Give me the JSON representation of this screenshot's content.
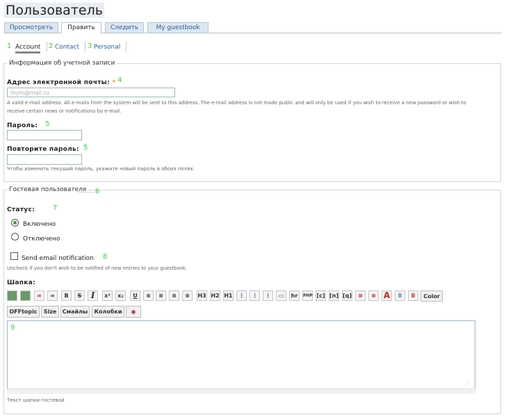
{
  "page": {
    "title": "Пользователь"
  },
  "tabs": [
    "Просмотреть",
    "Править",
    "Следить",
    "My guestbook"
  ],
  "subtabs": {
    "account": "Account",
    "contact": "Contact",
    "personal": "Personal"
  },
  "numbers": {
    "n1": "1",
    "n2": "2",
    "n3": "3",
    "n4": "4",
    "n5a": "5",
    "n5b": "5",
    "n6": "6",
    "n7": "7",
    "n8": "8",
    "n9": "9"
  },
  "account": {
    "legend": "Информация об учетной записи",
    "email_label": "Адрес электронной почты:",
    "required_mark": "*",
    "email_value": "mylo@mail.ru",
    "email_desc_1": "A valid e-mail address. All e-mails from the system will be sent to this address. The e-mail address is not made public and will only be used if you wish to receive a new password or wish to",
    "email_desc_2": "receive certain news or notifications by e-mail.",
    "pass_label": "Пароль:",
    "pass2_label": "Повторите пароль:",
    "pass_desc": "Чтобы изменить текущий пароль, укажите новый пароль в обоих полях."
  },
  "guestbook": {
    "legend": "Гостевая пользователя",
    "status_label": "Статус:",
    "on": "Включено",
    "off": "Отключено",
    "notify": "Send email notification",
    "notify_desc": "Uncheck if you don't wish to be notified of new entries to your guestbook.",
    "header_label": "Шапка:",
    "text_desc": "Текст шапки гостевой"
  },
  "toolbar": {
    "bold": "B",
    "strike": "S",
    "italic": "I",
    "sup": "x²",
    "sub": "x₂",
    "underline": "U",
    "h3": "H3",
    "h2": "H2",
    "h1": "H1",
    "hr": "hr",
    "php": "PHP",
    "c": "[c]",
    "n": "[n]",
    "q": "[q]",
    "color": "Color",
    "offtopic": "OFFtopic",
    "size": "Size",
    "smileys": "Смайлы",
    "kolobki": "Колобки"
  }
}
